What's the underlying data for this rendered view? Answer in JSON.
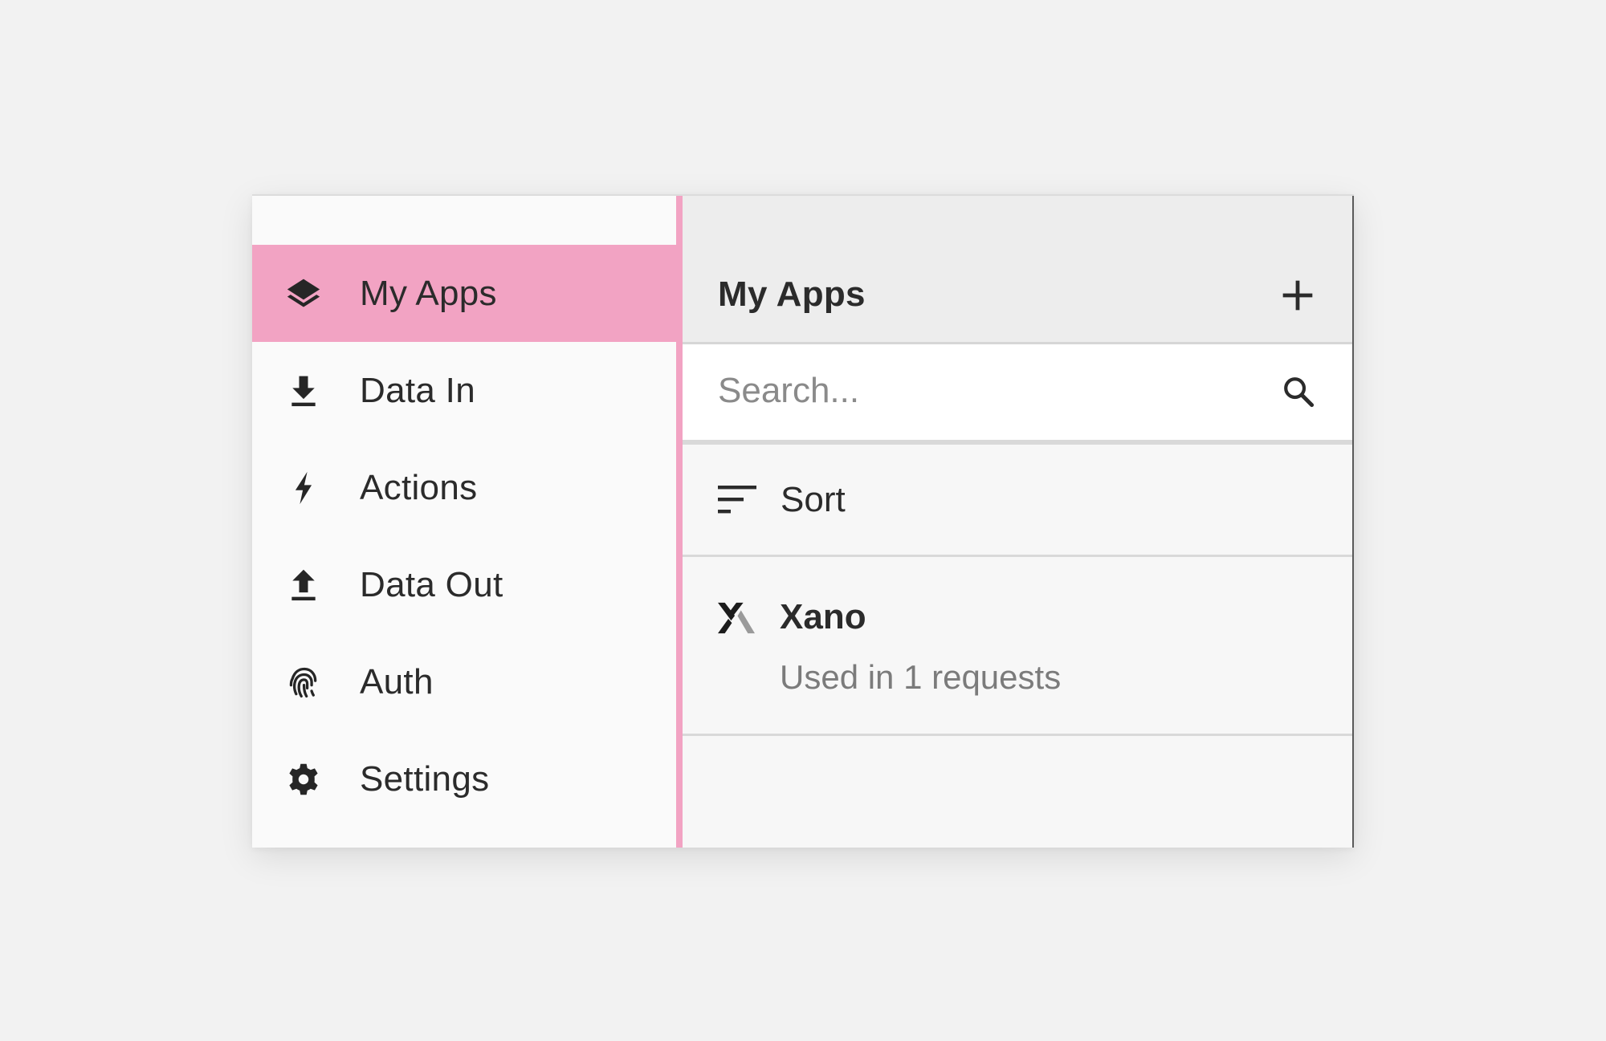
{
  "sidebar": {
    "items": [
      {
        "label": "My Apps",
        "icon": "layers-icon",
        "active": true
      },
      {
        "label": "Data In",
        "icon": "download-icon",
        "active": false
      },
      {
        "label": "Actions",
        "icon": "lightning-bolt-icon",
        "active": false
      },
      {
        "label": "Data Out",
        "icon": "upload-icon",
        "active": false
      },
      {
        "label": "Auth",
        "icon": "fingerprint-icon",
        "active": false
      },
      {
        "label": "Settings",
        "icon": "gear-icon",
        "active": false
      }
    ]
  },
  "panel": {
    "title": "My Apps",
    "add_icon": "plus-icon",
    "search": {
      "placeholder": "Search...",
      "value": "",
      "icon": "search-icon"
    },
    "sort": {
      "label": "Sort",
      "icon": "sort-icon"
    },
    "apps": [
      {
        "name": "Xano",
        "usage": "Used in 1 requests",
        "icon": "xano-logo-icon"
      }
    ]
  },
  "colors": {
    "accent": "#f2a3c3",
    "background": "#f2f2f2",
    "sidebar_bg": "#fafafa",
    "panel_header_bg": "#ededed",
    "text_primary": "#2b2b2b",
    "text_secondary": "#7b7b7b"
  }
}
